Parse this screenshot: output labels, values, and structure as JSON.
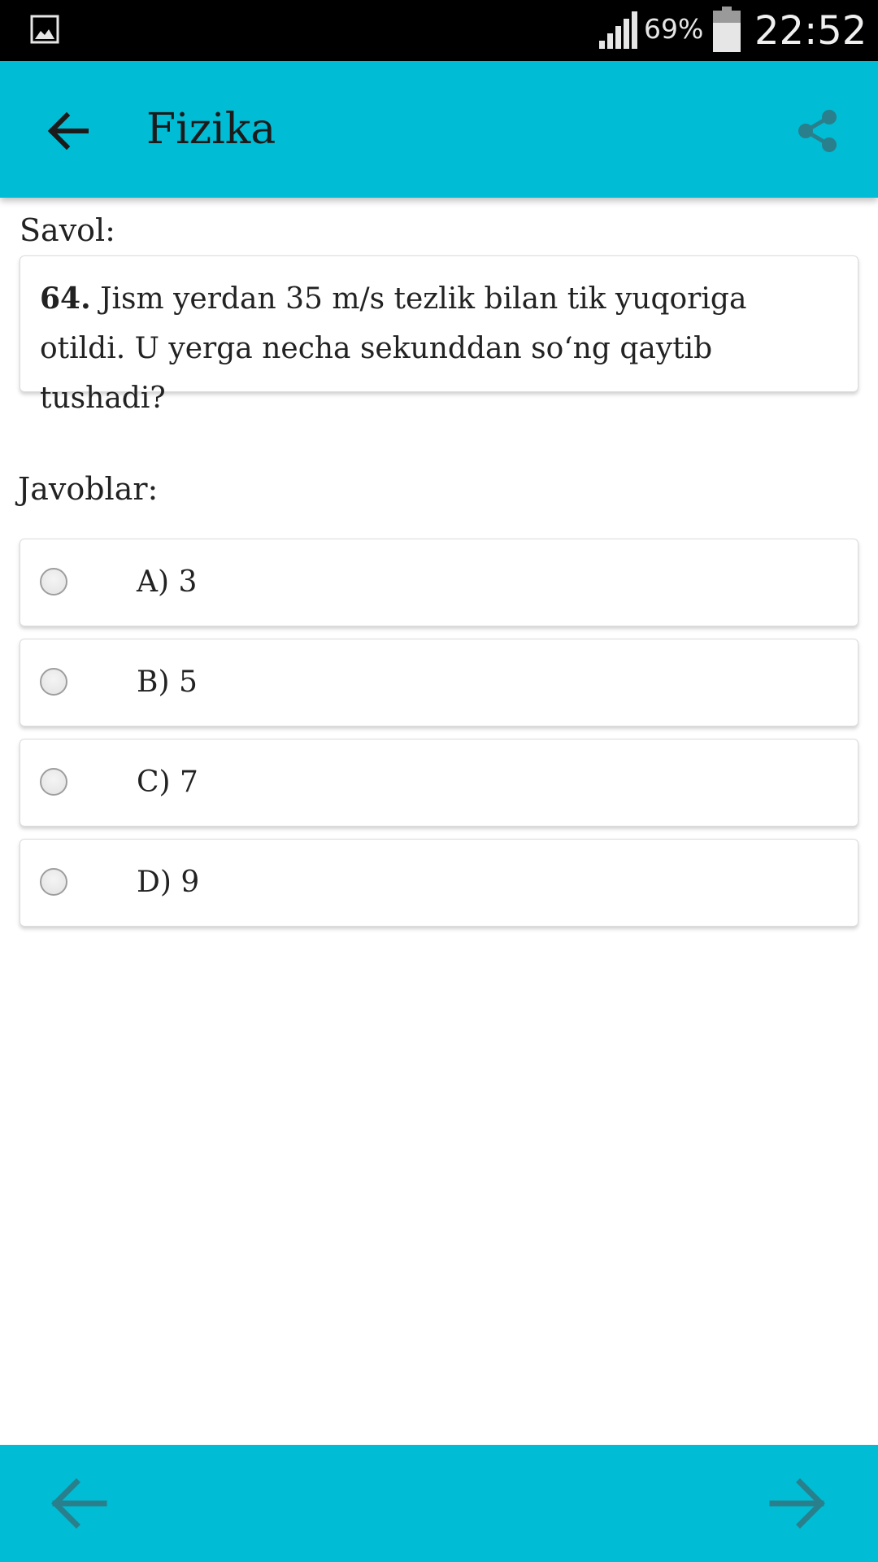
{
  "status_bar": {
    "battery_percent": "69%",
    "time": "22:52",
    "icons": [
      "gallery-icon",
      "signal-icon",
      "battery-icon"
    ]
  },
  "app_bar": {
    "title": "Fizika",
    "back_icon": "arrow-left-icon",
    "share_icon": "share-icon"
  },
  "question": {
    "section_label": "Savol:",
    "number": "64.",
    "text": " Jism yerdan 35 m/s tezlik bilan tik yuqoriga otildi. U yerga necha sekunddan so‘ng qaytib tushadi?"
  },
  "answers": {
    "section_label": "Javoblar:",
    "options": [
      {
        "label": "A) 3",
        "selected": false
      },
      {
        "label": "B) 5",
        "selected": false
      },
      {
        "label": "C) 7",
        "selected": false
      },
      {
        "label": "D) 9",
        "selected": false
      }
    ]
  },
  "bottom_bar": {
    "prev_icon": "arrow-left-icon",
    "next_icon": "arrow-right-icon"
  },
  "colors": {
    "accent": "#00bcd4",
    "status_bar": "#000000",
    "icon_dark": "#1b1b1b",
    "icon_teal": "#2a7f8c"
  }
}
